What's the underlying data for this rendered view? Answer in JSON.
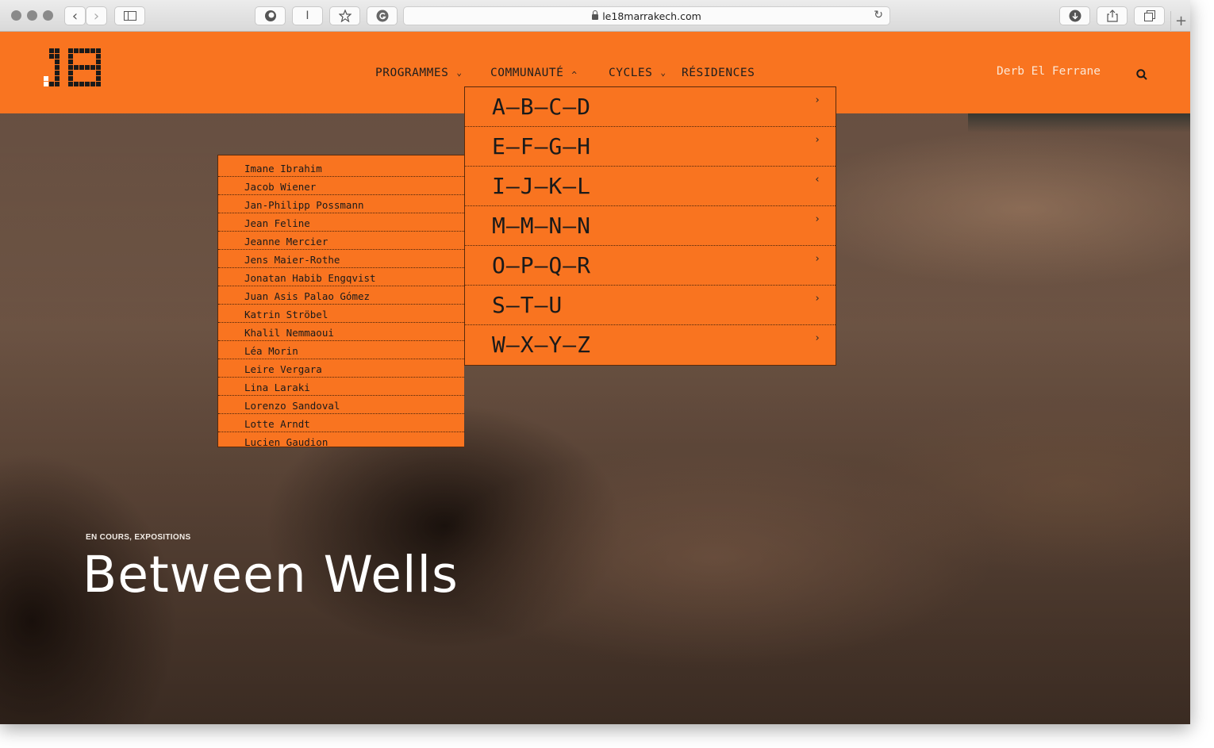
{
  "browser": {
    "url": "le18marrakech.com",
    "buttons": {
      "back": "‹",
      "forward": "›",
      "reader": "I",
      "plus": "+"
    }
  },
  "header": {
    "nav": [
      {
        "label": "PROGRAMMES",
        "chevron": "⌄"
      },
      {
        "label": "COMMUNAUTÉ",
        "chevron": "^"
      },
      {
        "label": "CYCLES",
        "chevron": "⌄"
      },
      {
        "label": "RÉSIDENCES",
        "chevron": ""
      }
    ],
    "right_link": "Derb El Ferrane",
    "brand_color": "#f97420"
  },
  "letters_menu": [
    {
      "label": "A—B—C—D",
      "arrow": "›"
    },
    {
      "label": "E—F—G—H",
      "arrow": "›"
    },
    {
      "label": "I—J—K—L",
      "arrow": "‹"
    },
    {
      "label": "M—M—N—N",
      "arrow": "›"
    },
    {
      "label": "O—P—Q—R",
      "arrow": "›"
    },
    {
      "label": "S—T—U",
      "arrow": "›"
    },
    {
      "label": "W—X—Y—Z",
      "arrow": "›"
    }
  ],
  "names_menu": [
    "Imane Ibrahim",
    "Jacob Wiener",
    "Jan-Philipp Possmann",
    "Jean Feline",
    "Jeanne Mercier",
    "Jens Maier-Rothe",
    "Jonatan Habib Engqvist",
    "Juan Asis Palao Gómez",
    "Katrin Ströbel",
    "Khalil Nemmaoui",
    "Léa Morin",
    "Leire Vergara",
    "Lina Laraki",
    "Lorenzo Sandoval",
    "Lotte Arndt",
    "Lucien Gaudion"
  ],
  "hero": {
    "category": "EN COURS, EXPOSITIONS",
    "title": "Between Wells"
  }
}
